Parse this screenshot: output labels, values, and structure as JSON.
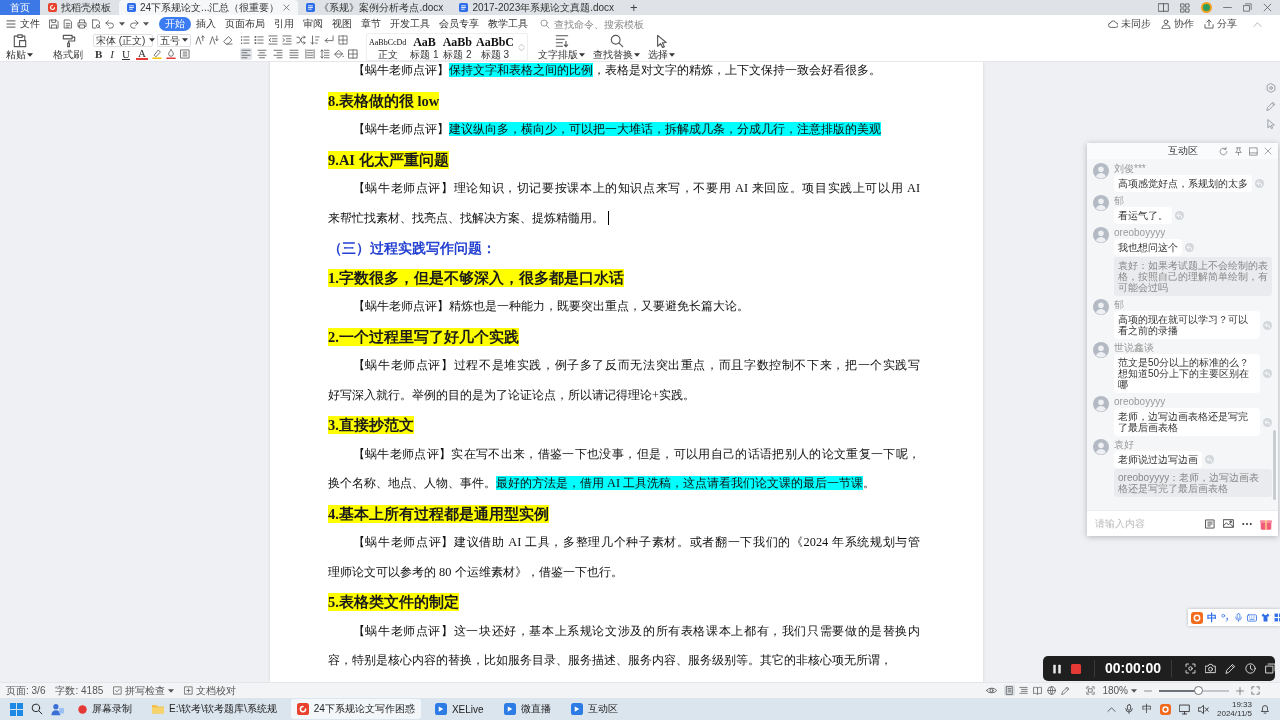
{
  "tabs": [
    {
      "kind": "home",
      "label": "首页",
      "selected": false
    },
    {
      "kind": "template",
      "label": "找稻壳模板",
      "selected": false
    },
    {
      "kind": "doc",
      "label": "24下系规论文...汇总（很重要）",
      "selected": true
    },
    {
      "kind": "doc",
      "label": "《系规》案例分析考点.docx",
      "selected": false
    },
    {
      "kind": "doc",
      "label": "2017-2023年系规论文真题.docx",
      "selected": false
    }
  ],
  "new_tab": "+",
  "menu": {
    "file": "文件",
    "items": [
      {
        "label": "开始",
        "selected": true
      },
      {
        "label": "插入",
        "selected": false
      },
      {
        "label": "页面布局",
        "selected": false
      },
      {
        "label": "引用",
        "selected": false
      },
      {
        "label": "审阅",
        "selected": false
      },
      {
        "label": "视图",
        "selected": false
      },
      {
        "label": "章节",
        "selected": false
      },
      {
        "label": "开发工具",
        "selected": false
      },
      {
        "label": "会员专享",
        "selected": false
      },
      {
        "label": "教学工具",
        "selected": false
      }
    ],
    "search": {
      "placeholder": "查找命令、搜索模板"
    },
    "actions": [
      "未同步",
      "协作",
      "分享"
    ]
  },
  "ribbon": {
    "paste": "粘贴",
    "format_painter": "格式刷",
    "font": "宋体 (正文)",
    "font_size": "五号",
    "format_keys": [
      "B",
      "I",
      "U",
      "A"
    ],
    "alignment": [
      {
        "selected": true
      },
      {
        "selected": false
      },
      {
        "selected": false
      },
      {
        "selected": false
      },
      {
        "selected": false
      }
    ],
    "styles": [
      {
        "kind": "body",
        "preview": "AaBbCcDd",
        "label": "正文",
        "selected": false
      },
      {
        "kind": "heading",
        "preview": "AaB",
        "label": "标题 1",
        "selected": false
      },
      {
        "kind": "heading",
        "preview": "AaBb",
        "label": "标题 2",
        "selected": false
      },
      {
        "kind": "heading",
        "preview": "AaBbC",
        "label": "标题 3",
        "selected": false
      }
    ],
    "tools": [
      "文字排版",
      "查找替换",
      "选择"
    ]
  },
  "document": {
    "blocks": [
      {
        "kind": "comment",
        "caret": false,
        "lines": [
          [
            {
              "text": "【蜗牛老师点评】",
              "highlighted": false
            },
            {
              "text": "保持文字和表格之间的比例",
              "highlighted": true
            },
            {
              "text": "，表格是对文字的精炼，上下文保持一致会好看很多。",
              "highlighted": false
            }
          ]
        ]
      },
      {
        "kind": "heading",
        "caret": false,
        "highlighted": true,
        "text": "8.表格做的很 low"
      },
      {
        "kind": "comment",
        "caret": false,
        "lines": [
          [
            {
              "text": "【蜗牛老师点评】",
              "highlighted": false
            },
            {
              "text": "建议纵向多，横向少，可以把一大堆话，拆解成几条，分成几行，注意排版的美观",
              "highlighted": true
            }
          ]
        ]
      },
      {
        "kind": "heading",
        "caret": false,
        "highlighted": true,
        "text": "9.AI 化太严重问题"
      },
      {
        "kind": "comment",
        "caret": true,
        "lines": [
          [
            {
              "text": "【蜗牛老师点评】理论知识，切记要按课本上的知识点来写，不要用 AI 来回应。项目实践上可以用 AI",
              "highlighted": false
            }
          ],
          [
            {
              "text": "来帮忙找素材、找亮点、找解决方案、提炼精髓用。",
              "highlighted": false
            }
          ]
        ]
      },
      {
        "kind": "section",
        "caret": false,
        "highlighted": false,
        "text": "（三）过程实践写作问题："
      },
      {
        "kind": "heading",
        "caret": false,
        "highlighted": true,
        "text": "1.字数很多，但是不够深入，很多都是口水话"
      },
      {
        "kind": "comment",
        "caret": false,
        "lines": [
          [
            {
              "text": "【蜗牛老师点评】精炼也是一种能力，既要突出重点，又要避免长篇大论。",
              "highlighted": false
            }
          ]
        ]
      },
      {
        "kind": "heading",
        "caret": false,
        "highlighted": true,
        "text": "2.一个过程里写了好几个实践"
      },
      {
        "kind": "comment",
        "caret": false,
        "lines": [
          [
            {
              "text": "【蜗牛老师点评】过程不是堆实践，例子多了反而无法突出重点，而且字数控制不下来，把一个实践写",
              "highlighted": false
            }
          ],
          [
            {
              "text": "好写深入就行。举例的目的是为了论证论点，所以请记得理论+实践。",
              "highlighted": false
            }
          ]
        ]
      },
      {
        "kind": "heading",
        "caret": false,
        "highlighted": true,
        "text": "3.直接抄范文"
      },
      {
        "kind": "comment",
        "caret": false,
        "lines": [
          [
            {
              "text": "【蜗牛老师点评】实在写不出来，借鉴一下也没事，但是，可以用自己的话语把别人的论文重复一下呢，",
              "highlighted": false
            }
          ],
          [
            {
              "text": "换个名称、地点、人物、事件。",
              "highlighted": false
            },
            {
              "text": "最好的方法是，借用 AI 工具洗稿，这点请看我们论文课的最后一节课",
              "highlighted": true
            },
            {
              "text": "。",
              "highlighted": false
            }
          ]
        ]
      },
      {
        "kind": "heading",
        "caret": false,
        "highlighted": true,
        "text": "4.基本上所有过程都是通用型实例"
      },
      {
        "kind": "comment",
        "caret": false,
        "lines": [
          [
            {
              "text": "【蜗牛老师点评】建议借助 AI 工具，多整理几个种子素材。或者翻一下我们的《2024 年系统规划与管",
              "highlighted": false
            }
          ],
          [
            {
              "text": "理师论文可以参考的 80 个运维素材》，借鉴一下也行。",
              "highlighted": false
            }
          ]
        ]
      },
      {
        "kind": "heading",
        "caret": false,
        "highlighted": true,
        "text": "5.表格类文件的制定"
      },
      {
        "kind": "comment",
        "caret": false,
        "lines": [
          [
            {
              "text": "【蜗牛老师点评】这一块还好，基本上系规论文涉及的所有表格课本上都有，我们只需要做的是替换内",
              "highlighted": false
            }
          ],
          [
            {
              "text": "容，特别是核心内容的替换，比如服务目录、服务描述、服务内容、服务级别等。其它的非核心项无所谓，",
              "highlighted": false
            }
          ]
        ]
      }
    ]
  },
  "side_panel": {
    "title": "互动区",
    "messages": [
      {
        "user": "刘俊***",
        "text": "高项感觉好点，系规划的太多"
      },
      {
        "user": "郁",
        "text": "看运气了。"
      },
      {
        "user": "oreoboyyyy",
        "text": "我也想问这个",
        "quote": "袁好：如果考试题上不会绘制的表格，按照自己的理解简单绘制，有可能会过吗"
      },
      {
        "user": "郁",
        "text": "高项的现在就可以学习？可以看之前的录播"
      },
      {
        "user": "世说鑫谈",
        "text": "范文是50分以上的标准的么？想知道50分上下的主要区别在哪"
      },
      {
        "user": "oreoboyyyy",
        "text": "老师，边写边画表格还是写完了最后画表格"
      },
      {
        "user": "袁好",
        "text": "老师说过边写边画",
        "quote": "oreoboyyyy：老师，边写边画表格还是写完了最后画表格"
      }
    ],
    "input": {
      "placeholder": "请输入内容"
    }
  },
  "recorder": {
    "time": "00:00:00"
  },
  "ime_bar": {
    "mode": "中"
  },
  "status_bar": {
    "page": "页面: 3/6",
    "words": "字数: 4185",
    "spell_check": "拼写检查",
    "proofread": "文档校对",
    "views": [
      {
        "selected": true
      },
      {
        "selected": false
      },
      {
        "selected": false
      },
      {
        "selected": false
      },
      {
        "selected": false
      }
    ],
    "zoom": "180%",
    "zoom_slider": {
      "level": 0.58
    }
  },
  "taskbar": {
    "apps": [
      {
        "kind": "recorder",
        "label": "屏幕录制",
        "selected": false
      },
      {
        "kind": "folder",
        "label": "E:\\软考\\软考题库\\系统规",
        "selected": false
      },
      {
        "kind": "office",
        "label": "24下系规论文写作困惑",
        "selected": true
      },
      {
        "kind": "app",
        "label": "XELive",
        "selected": false
      },
      {
        "kind": "app",
        "label": "微直播",
        "selected": false
      },
      {
        "kind": "app",
        "label": "互动区",
        "selected": false
      }
    ],
    "ime": "中",
    "time": "19:33",
    "date": "2024/11/5"
  }
}
